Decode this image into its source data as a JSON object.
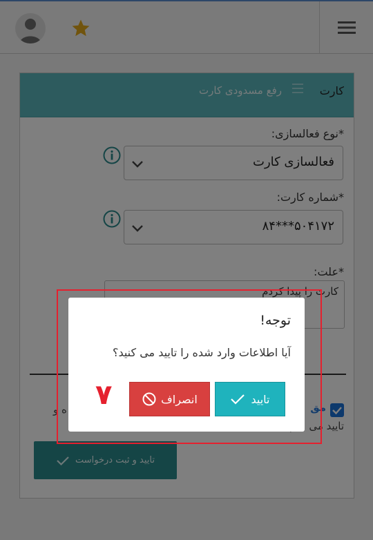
{
  "topbar": {
    "menu_icon": "hamburger-icon",
    "avatar_icon": "user-avatar-icon",
    "star_icon": "star-icon",
    "star_color": "#e2a91a"
  },
  "panel": {
    "title": "کارت",
    "subtitle": "رفع مسدودی کارت",
    "subtitle_icon": "list-icon",
    "activation_type": {
      "label": "*نوع فعالسازی:",
      "value": "فعالسازی کارت"
    },
    "card_number": {
      "label": "*شماره کارت:",
      "value": "۵۰۴۱۷۲***۸۴"
    },
    "reason": {
      "label": "*علت:",
      "value": "کارت را پیدا کردم"
    },
    "terms": {
      "link_fragment": "مق",
      "fragment_left": "ه و",
      "fragment_line2": "تایید می ...م"
    },
    "submit_label": "تایید و ثبت درخواست"
  },
  "modal": {
    "title": "توجه!",
    "message": "آیا اطلاعات وارد شده را تایید می کنید؟",
    "confirm_label": "تایید",
    "cancel_label": "انصراف"
  },
  "annotation": {
    "step_number": "۷",
    "color": "#e5202e"
  }
}
